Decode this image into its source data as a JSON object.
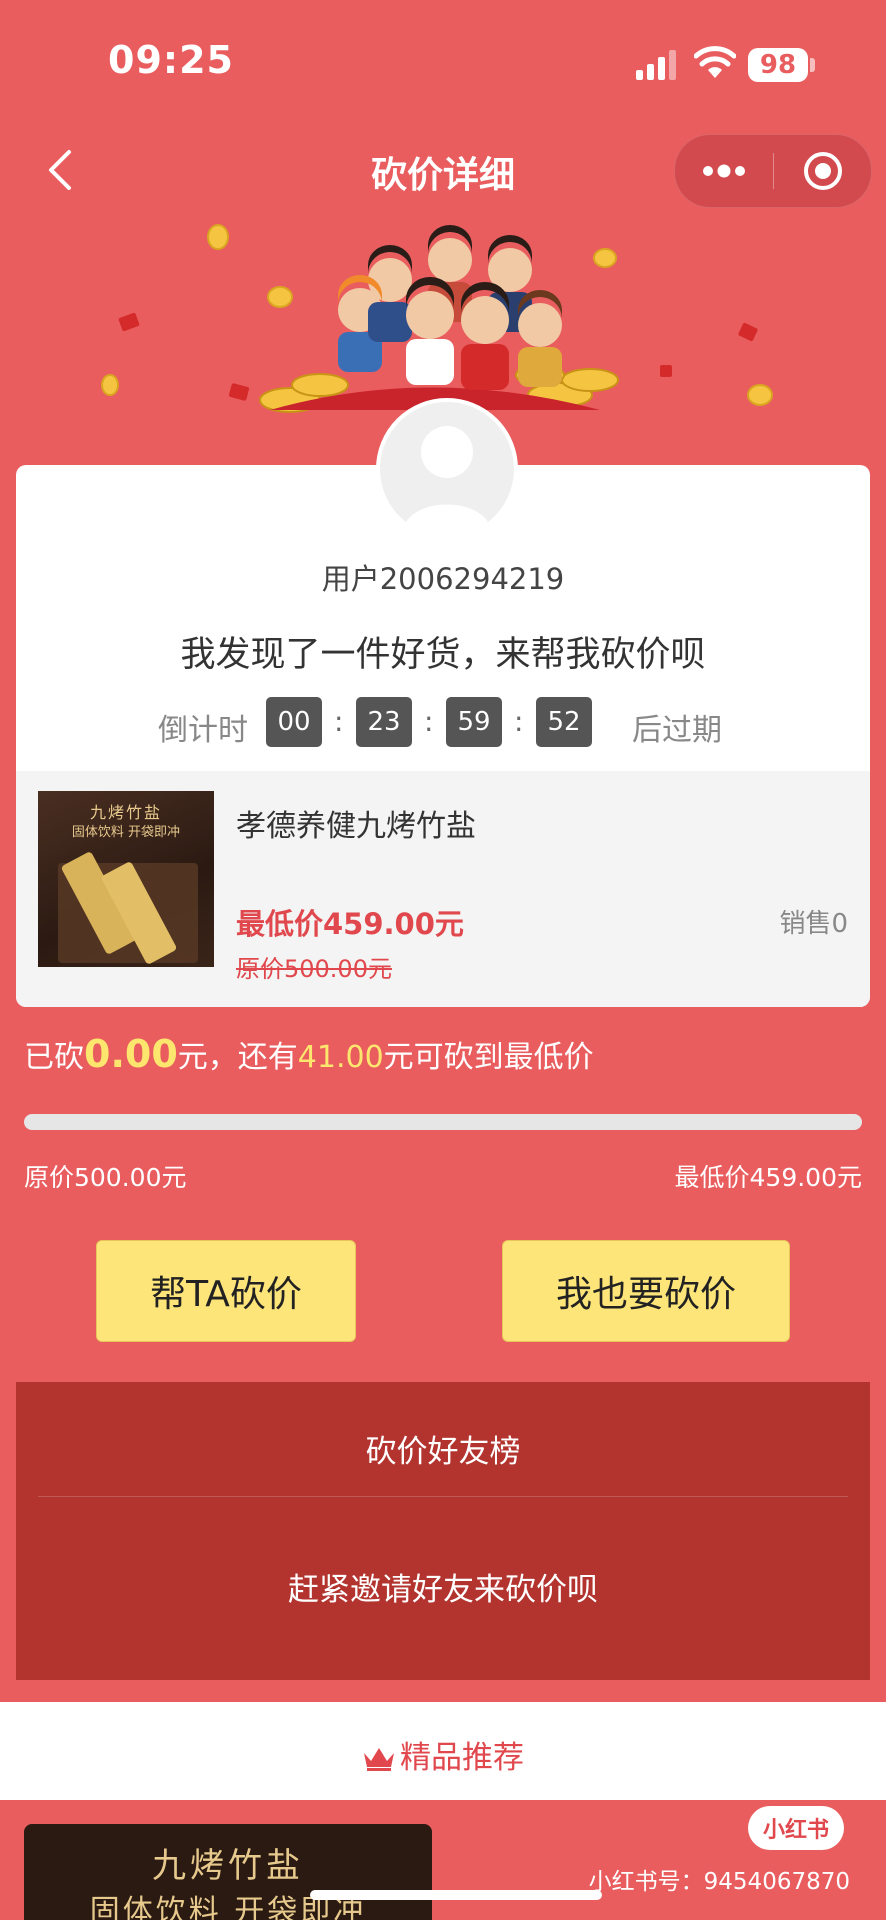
{
  "status_bar": {
    "time": "09:25",
    "battery": "98"
  },
  "nav": {
    "title": "砍价详细"
  },
  "user": {
    "name": "用户2006294219",
    "message": "我发现了一件好货，来帮我砍价呗"
  },
  "countdown": {
    "prefix": "倒计时",
    "hours": "00",
    "minutes": "23",
    "seconds": "59",
    "centis": "52",
    "suffix": "后过期",
    "sep": ":"
  },
  "product": {
    "name": "孝德养健九烤竹盐",
    "min_price": "最低价459.00元",
    "orig_price": "原价500.00元",
    "sales": "销售0",
    "image_line1": "九烤竹盐",
    "image_line2": "固体饮料 开袋即冲"
  },
  "bargain": {
    "pre": "已砍",
    "cut_amount": "0.00",
    "mid": "元，还有",
    "remaining": "41.00",
    "post": "元可砍到最低价",
    "progress": 0,
    "left_label": "原价500.00元",
    "right_label": "最低价459.00元"
  },
  "buttons": {
    "help": "帮TA砍价",
    "mine": "我也要砍价"
  },
  "friend_board": {
    "title": "砍价好友榜",
    "empty": "赶紧邀请好友来砍价呗"
  },
  "recommend": {
    "title": "精品推荐",
    "item_line1": "九烤竹盐",
    "item_line2": "固体饮料 开袋即冲"
  },
  "watermark": {
    "badge": "小红书",
    "id": "小红书号：9454067870"
  },
  "colors": {
    "background": "#e95d5f",
    "accent_yellow": "#fde66e",
    "price_red": "#e0484d",
    "board": "#b3342f"
  }
}
